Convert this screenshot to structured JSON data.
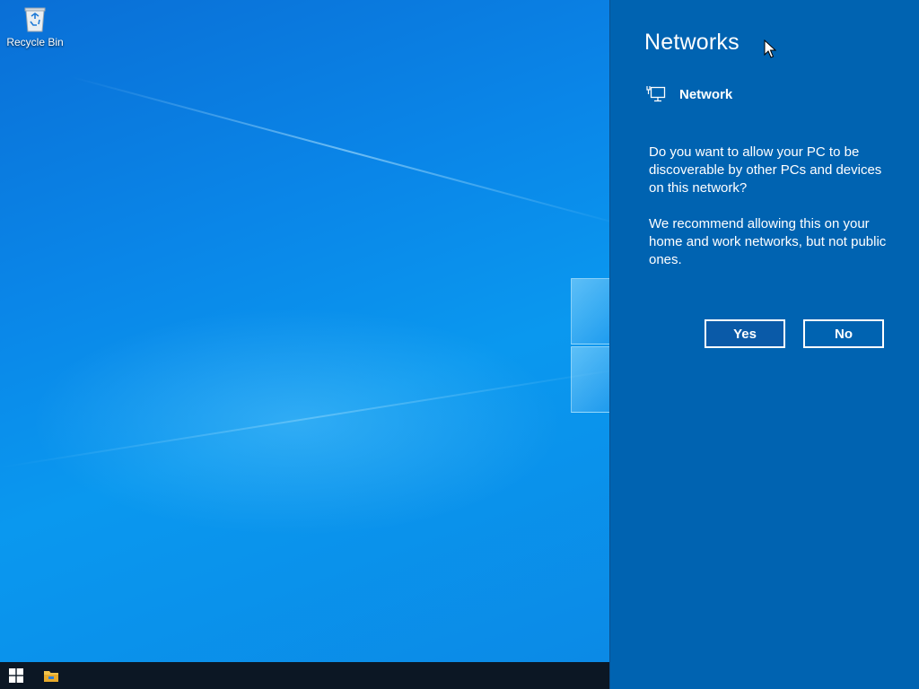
{
  "desktop": {
    "icons": [
      {
        "label": "Recycle Bin",
        "icon": "recycle-bin-icon"
      }
    ],
    "wallpaper_colors": [
      "#0a6fd6",
      "#0a98ef"
    ]
  },
  "taskbar": {
    "start_icon": "windows-start-icon",
    "pinned": [
      {
        "icon": "file-explorer-icon"
      }
    ],
    "color": "#0c1724"
  },
  "networks_panel": {
    "title": "Networks",
    "network_icon": "ethernet-icon",
    "network_name": "Network",
    "prompt": "Do you want to allow your PC to be discoverable by other PCs and devices on this network?",
    "recommendation": "We recommend allowing this on your home and work networks, but not public ones.",
    "buttons": {
      "yes_label": "Yes",
      "no_label": "No"
    },
    "accent_color": "#0063b1"
  }
}
